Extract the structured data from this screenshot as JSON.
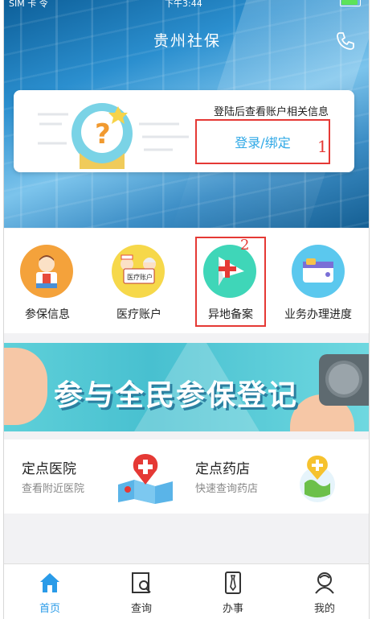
{
  "status_bar": {
    "carrier": "SIM 卡 令",
    "time": "下午3:44"
  },
  "header": {
    "title": "贵州社保",
    "phone_icon": "phone-icon"
  },
  "login_card": {
    "hint": "登陆后查看账户相关信息",
    "button_label": "登录/绑定",
    "annotation": "1",
    "illustration_icon": "question-avatar-icon"
  },
  "quick_menu": {
    "items": [
      {
        "label": "参保信息",
        "icon": "insurance-info-icon",
        "color": "#f4a23b"
      },
      {
        "label": "医疗账户",
        "icon": "medical-account-icon",
        "color": "#f6d84a",
        "badge_text": "医疗账户"
      },
      {
        "label": "异地备案",
        "icon": "remote-filing-icon",
        "color": "#3fd6b8"
      },
      {
        "label": "业务办理进度",
        "icon": "progress-icon",
        "color": "#5bc8ee"
      }
    ],
    "annotation": "2"
  },
  "banner": {
    "text": "参与全民参保登记"
  },
  "points": [
    {
      "title": "定点医院",
      "subtitle": "查看附近医院",
      "icon": "hospital-map-icon"
    },
    {
      "title": "定点药店",
      "subtitle": "快速查询药店",
      "icon": "pharmacy-globe-icon"
    }
  ],
  "tab_bar": {
    "active_color": "#2a9be8",
    "items": [
      {
        "label": "首页",
        "icon": "home-icon",
        "active": true
      },
      {
        "label": "查询",
        "icon": "search-doc-icon",
        "active": false
      },
      {
        "label": "办事",
        "icon": "tie-icon",
        "active": false
      },
      {
        "label": "我的",
        "icon": "user-icon",
        "active": false
      }
    ]
  }
}
